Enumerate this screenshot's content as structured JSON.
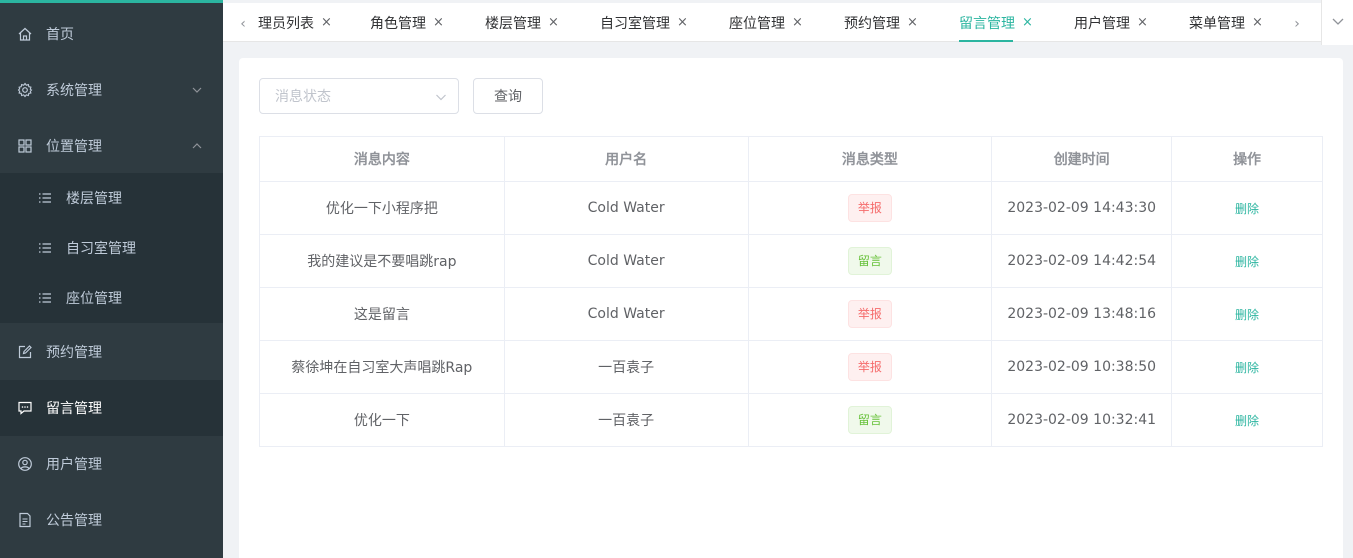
{
  "sidebar": {
    "items": [
      {
        "label": "首页",
        "icon": "home-icon"
      },
      {
        "label": "系统管理",
        "icon": "gear-icon"
      },
      {
        "label": "位置管理",
        "icon": "grid-icon"
      },
      {
        "label": "预约管理",
        "icon": "edit-icon"
      },
      {
        "label": "留言管理",
        "icon": "chat-icon"
      },
      {
        "label": "用户管理",
        "icon": "user-icon"
      },
      {
        "label": "公告管理",
        "icon": "document-icon"
      }
    ],
    "sub_items": [
      {
        "label": "楼层管理",
        "icon": "list-icon"
      },
      {
        "label": "自习室管理",
        "icon": "list-icon"
      },
      {
        "label": "座位管理",
        "icon": "list-icon"
      }
    ]
  },
  "tabs": [
    {
      "label": "理员列表"
    },
    {
      "label": "角色管理"
    },
    {
      "label": "楼层管理"
    },
    {
      "label": "自习室管理"
    },
    {
      "label": "座位管理"
    },
    {
      "label": "预约管理"
    },
    {
      "label": "留言管理"
    },
    {
      "label": "用户管理"
    },
    {
      "label": "菜单管理"
    }
  ],
  "tabs_nav": {
    "prev": "‹",
    "next": "›",
    "close": "×"
  },
  "filter": {
    "status_placeholder": "消息状态",
    "query_button": "查询"
  },
  "table": {
    "headers": [
      "消息内容",
      "用户名",
      "消息类型",
      "创建时间",
      "操作"
    ],
    "rows": [
      {
        "content": "优化一下小程序把",
        "user": "Cold Water",
        "type": "举报",
        "time": "2023-02-09 14:43:30",
        "action": "删除"
      },
      {
        "content": "我的建议是不要唱跳rap",
        "user": "Cold Water",
        "type": "留言",
        "time": "2023-02-09 14:42:54",
        "action": "删除"
      },
      {
        "content": "这是留言",
        "user": "Cold Water",
        "type": "举报",
        "time": "2023-02-09 13:48:16",
        "action": "删除"
      },
      {
        "content": "蔡徐坤在自习室大声唱跳Rap",
        "user": "一百袁子",
        "type": "举报",
        "time": "2023-02-09 10:38:50",
        "action": "删除"
      },
      {
        "content": "优化一下",
        "user": "一百袁子",
        "type": "留言",
        "time": "2023-02-09 10:32:41",
        "action": "删除"
      }
    ]
  },
  "colors": {
    "accent": "#2bb5a0",
    "sidebar_bg": "#2f3b41",
    "sidebar_sub_bg": "#263238",
    "report": "#f56c6c",
    "message": "#67c23a"
  }
}
